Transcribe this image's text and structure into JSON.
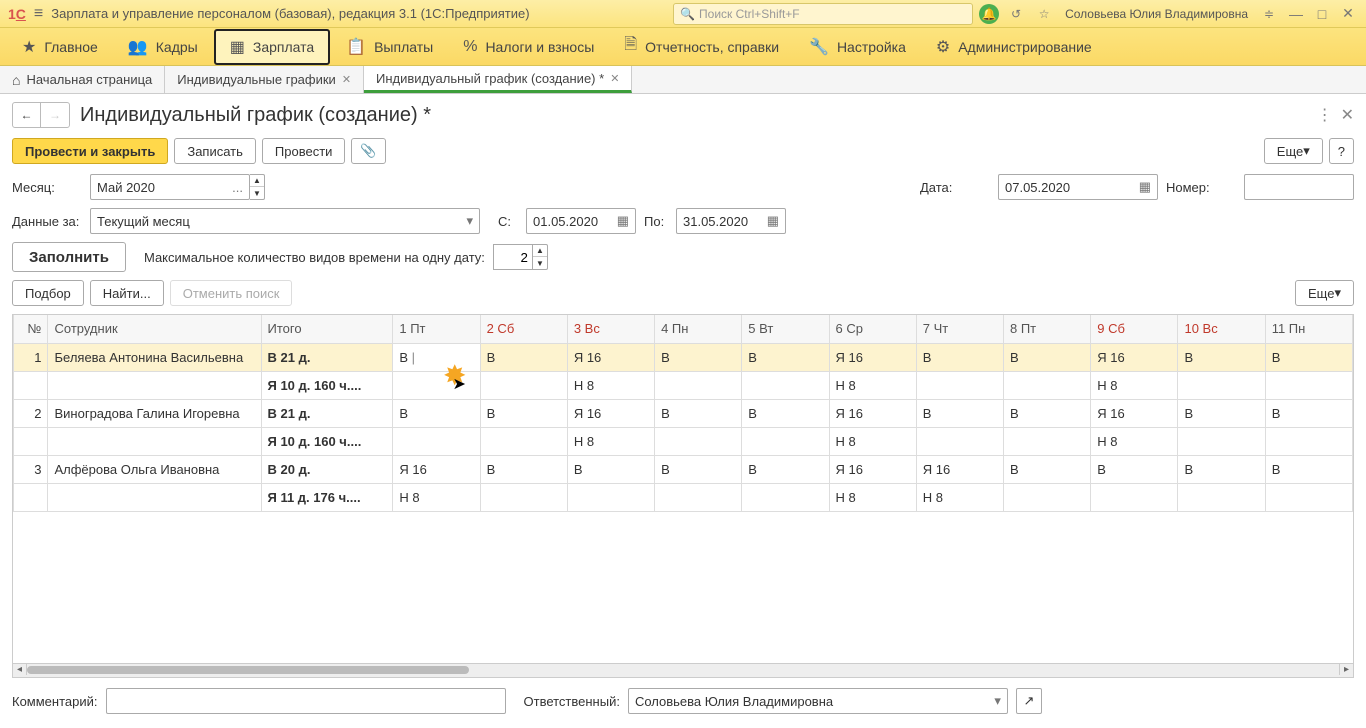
{
  "titlebar": {
    "app_title": "Зарплата и управление персоналом (базовая), редакция 3.1  (1С:Предприятие)",
    "search_placeholder": "Поиск Ctrl+Shift+F",
    "user": "Соловьева Юлия Владимировна"
  },
  "menu": {
    "items": [
      {
        "icon": "★",
        "label": "Главное"
      },
      {
        "icon": "👥",
        "label": "Кадры"
      },
      {
        "icon": "▦",
        "label": "Зарплата"
      },
      {
        "icon": "📋",
        "label": "Выплаты"
      },
      {
        "icon": "%",
        "label": "Налоги и взносы"
      },
      {
        "icon": "🗎",
        "label": "Отчетность, справки"
      },
      {
        "icon": "🔧",
        "label": "Настройка"
      },
      {
        "icon": "⚙",
        "label": "Администрирование"
      }
    ],
    "selected": 2
  },
  "tabs": {
    "items": [
      {
        "label": "Начальная страница",
        "home": true
      },
      {
        "label": "Индивидуальные графики"
      },
      {
        "label": "Индивидуальный график (создание) *",
        "active": true
      }
    ]
  },
  "page": {
    "title": "Индивидуальный график (создание) *",
    "btn_post_close": "Провести и закрыть",
    "btn_write": "Записать",
    "btn_post": "Провести",
    "btn_more": "Еще",
    "btn_help": "?",
    "lbl_month": "Месяц:",
    "val_month": "Май 2020",
    "lbl_date": "Дата:",
    "val_date": "07.05.2020",
    "lbl_number": "Номер:",
    "val_number": "",
    "lbl_data_for": "Данные за:",
    "val_data_for": "Текущий месяц",
    "lbl_from": "С:",
    "val_from": "01.05.2020",
    "lbl_to": "По:",
    "val_to": "31.05.2020",
    "btn_fill": "Заполнить",
    "lbl_max_types": "Максимальное количество видов времени на одну дату:",
    "val_max_types": "2",
    "btn_pick": "Подбор",
    "btn_find": "Найти...",
    "btn_cancel_search": "Отменить поиск",
    "btn_more2": "Еще"
  },
  "grid": {
    "headers": {
      "num": "№",
      "emp": "Сотрудник",
      "total": "Итого",
      "days": [
        {
          "label": "1 Пт",
          "weekend": false
        },
        {
          "label": "2 Сб",
          "weekend": true
        },
        {
          "label": "3 Вс",
          "weekend": true
        },
        {
          "label": "4 Пн",
          "weekend": false
        },
        {
          "label": "5 Вт",
          "weekend": false
        },
        {
          "label": "6 Ср",
          "weekend": false
        },
        {
          "label": "7 Чт",
          "weekend": false
        },
        {
          "label": "8 Пт",
          "weekend": false
        },
        {
          "label": "9 Сб",
          "weekend": true
        },
        {
          "label": "10 Вс",
          "weekend": true
        },
        {
          "label": "11 Пн",
          "weekend": false
        }
      ]
    },
    "rows": [
      {
        "num": "1",
        "emp": "Беляева Антонина Васильевна",
        "total1": "В 21 д.",
        "d1": [
          "В",
          "В",
          "Я 16",
          "В",
          "В",
          "Я 16",
          "В",
          "В",
          "Я 16",
          "В",
          "В"
        ],
        "total2": "Я 10 д. 160 ч....",
        "d2": [
          "",
          "",
          "Н 8",
          "",
          "",
          "Н 8",
          "",
          "",
          "Н 8",
          "",
          ""
        ],
        "editing_col": 0,
        "highlight": true
      },
      {
        "num": "2",
        "emp": "Виноградова Галина Игоревна",
        "total1": "В 21 д.",
        "d1": [
          "В",
          "В",
          "Я 16",
          "В",
          "В",
          "Я 16",
          "В",
          "В",
          "Я 16",
          "В",
          "В"
        ],
        "total2": "Я 10 д. 160 ч....",
        "d2": [
          "",
          "",
          "Н 8",
          "",
          "",
          "Н 8",
          "",
          "",
          "Н 8",
          "",
          ""
        ]
      },
      {
        "num": "3",
        "emp": "Алфёрова Ольга Ивановна",
        "total1": "В 20 д.",
        "d1": [
          "Я 16",
          "В",
          "В",
          "В",
          "В",
          "Я 16",
          "Я 16",
          "В",
          "В",
          "В",
          "В"
        ],
        "total2": "Я 11 д. 176 ч....",
        "d2": [
          "Н 8",
          "",
          "",
          "",
          "",
          "Н 8",
          "Н 8",
          "",
          "",
          "",
          ""
        ]
      }
    ]
  },
  "footer": {
    "lbl_comment": "Комментарий:",
    "val_comment": "",
    "lbl_resp": "Ответственный:",
    "val_resp": "Соловьева Юлия Владимировна"
  }
}
